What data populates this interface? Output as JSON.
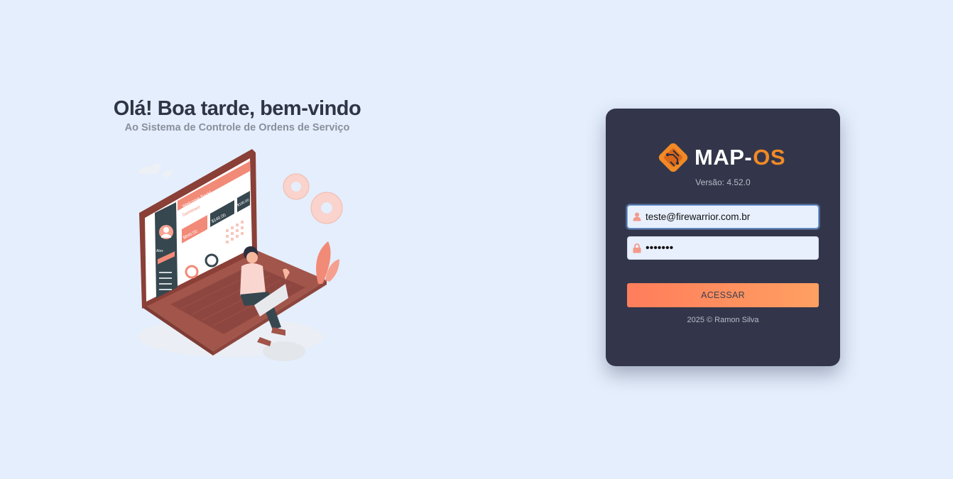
{
  "hero": {
    "title": "Olá! Boa tarde, bem-vindo",
    "subtitle": "Ao Sistema de Controle de Ordens de Serviço"
  },
  "illustration": {
    "screen_welcome": "Welcome Back!",
    "screen_dashboard": "Dashboard",
    "stat_1": "$840.00",
    "stat_2": "$140.00",
    "stat_3": "$100.00",
    "user_name": "Alex"
  },
  "login": {
    "logo_text": "MAP-",
    "logo_os": "OS",
    "version": "Versão: 4.52.0",
    "email_value": "teste@firewarrior.com.br",
    "password_value": "1234567",
    "submit_label": "ACESSAR",
    "footer": "2025 © Ramon Silva"
  },
  "colors": {
    "background": "#e4eefc",
    "card": "#33364a",
    "accent": "#f18a26",
    "button_start": "#ff7d5b",
    "button_end": "#ffa062"
  },
  "icons": {
    "email": "user-icon",
    "password": "lock-icon",
    "logo": "circuit-board-icon"
  }
}
